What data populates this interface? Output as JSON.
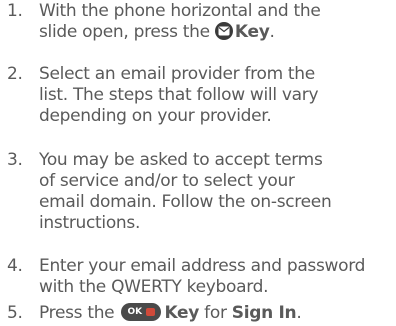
{
  "steps": [
    {
      "number": "1.",
      "line1_pre": "With the phone horizontal and the",
      "line2_pre": "slide open, press the",
      "key_icon": "message-key-icon",
      "key_label": "Key",
      "line2_post": "."
    },
    {
      "number": "2.",
      "lines": [
        "Select an email provider from the",
        "list. The steps that follow will vary",
        "depending on your provider."
      ]
    },
    {
      "number": "3.",
      "lines": [
        "You may be asked to accept terms",
        "of service and/or to select your",
        "email domain. Follow the on-screen",
        "instructions."
      ]
    },
    {
      "number": "4.",
      "lines": [
        "Enter your email address and password",
        "with the QWERTY keyboard."
      ]
    },
    {
      "number": "5.",
      "pre": "Press the",
      "key_icon": "ok-key-icon",
      "key_text": "OK",
      "key_label": "Key",
      "mid": "for",
      "action": "Sign In",
      "post": "."
    }
  ]
}
